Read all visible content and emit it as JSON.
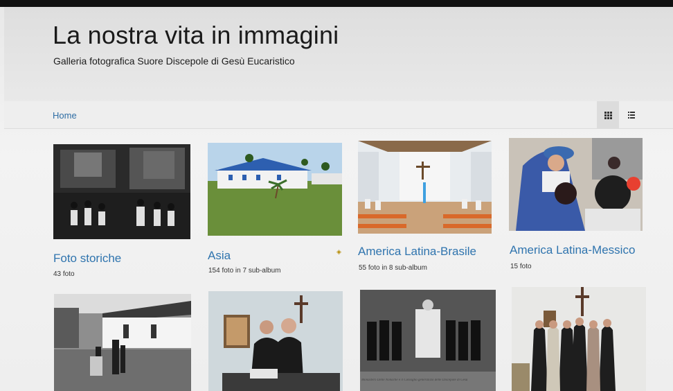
{
  "header": {
    "title": "La nostra vita in immagini",
    "subtitle": "Galleria fotografica Suore Discepole di Gesù Eucaristico"
  },
  "nav": {
    "home": "Home",
    "view_grid_icon": "grid-icon",
    "view_list_icon": "list-icon"
  },
  "albums": [
    {
      "title": "Foto storiche",
      "count": "43 foto",
      "theme": "historic-photo"
    },
    {
      "title": "Asia",
      "count": "154 foto in 7 sub-album",
      "theme": "tropical-building"
    },
    {
      "title": "America Latina-Brasile",
      "count": "55 foto in 8 sub-album",
      "theme": "chapel-interior"
    },
    {
      "title": "America Latina-Messico",
      "count": "15 foto",
      "theme": "nun-portrait"
    }
  ],
  "row2": [
    {
      "theme": "village-scene"
    },
    {
      "theme": "office-meeting"
    },
    {
      "theme": "nuns-group-bw",
      "caption": "Monastero Delle Nonache e il Consiglio generalizio delle Discepole di Gesù"
    },
    {
      "theme": "nuns-group-color"
    }
  ],
  "colors": {
    "link": "#2f74ae",
    "title": "#1a1a1a",
    "active_view": "#dcdcdc"
  }
}
